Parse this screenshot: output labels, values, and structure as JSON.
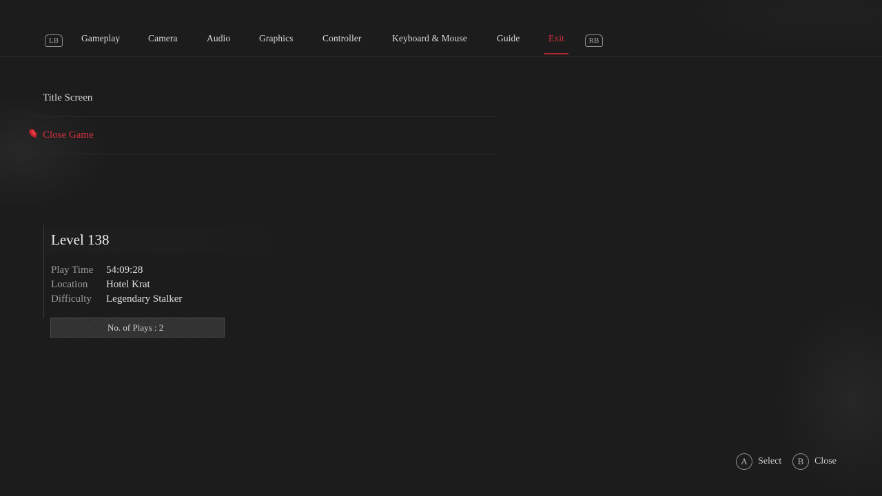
{
  "top_nav": {
    "left_bumper": "LB",
    "right_bumper": "RB",
    "tabs": [
      {
        "label": "Gameplay"
      },
      {
        "label": "Camera"
      },
      {
        "label": "Audio"
      },
      {
        "label": "Graphics"
      },
      {
        "label": "Controller"
      },
      {
        "label": "Keyboard & Mouse"
      },
      {
        "label": "Guide"
      },
      {
        "label": "Exit",
        "active": true
      }
    ]
  },
  "menu": {
    "items": [
      {
        "label": "Title Screen"
      },
      {
        "label": "Close Game",
        "selected": true
      }
    ]
  },
  "save_info": {
    "level": "Level 138",
    "rows": [
      {
        "key": "Play Time",
        "value": "54:09:28"
      },
      {
        "key": "Location",
        "value": "Hotel Krat"
      },
      {
        "key": "Difficulty",
        "value": "Legendary Stalker"
      }
    ],
    "plays": "No. of Plays : 2"
  },
  "hints": {
    "select_button": "A",
    "select_label": "Select",
    "close_button": "B",
    "close_label": "Close"
  },
  "colors": {
    "accent": "#d3303b",
    "background": "#1c1c1d"
  }
}
